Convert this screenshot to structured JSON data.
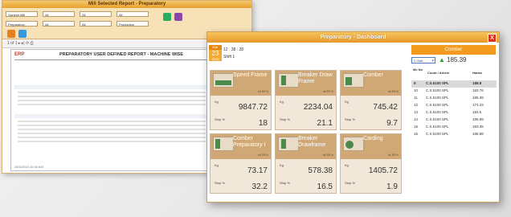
{
  "report_window": {
    "title": "Mill Selected Report - Preparatory",
    "filters": [
      {
        "label": "Mill/Plant",
        "value": "Ganesh Mill",
        "type": "select"
      },
      {
        "label": "From",
        "value": "28",
        "type": "select"
      },
      {
        "label": "To",
        "value": "28",
        "type": "select"
      },
      {
        "label": "Shift",
        "value": "All",
        "type": "select"
      },
      {
        "label": "Dept",
        "value": "Preparatory",
        "type": "select"
      },
      {
        "label": "Machine Type",
        "value": "All",
        "type": "select"
      },
      {
        "label": "Machine",
        "value": "All",
        "type": "select"
      },
      {
        "label": "Report",
        "value": "Production",
        "type": "select"
      }
    ],
    "toolbar_text": "1 of 1  ▸ ▸|  ⟳  ⎙",
    "report_logo": "ERP",
    "report_title": "PREPARATORY USER DEFINED REPORT - MACHINE WISE",
    "report_footer": "28/3/2015 10:40 AM"
  },
  "dashboard": {
    "title": "Preparatory - Dashboard",
    "close_label": "X",
    "date": {
      "month": "Mar",
      "day": "23",
      "year": "2015"
    },
    "time": "12 : 38 : 28",
    "shift": "Shift 1",
    "kg_label": "Kg",
    "stop_label": "Stop %",
    "tiles": [
      {
        "name": "Speed Frame",
        "eff": "## Eff %",
        "kg": "9847.72",
        "stop": "18"
      },
      {
        "name": "Breaker Draw Frame",
        "eff": "## Eff %",
        "kg": "2234.04",
        "stop": "21.1"
      },
      {
        "name": "Comber",
        "eff": "## Eff %",
        "kg": "745.42",
        "stop": "9.7"
      },
      {
        "name": "Comber Preparatory I",
        "eff": "## Eff %",
        "kg": "73.17",
        "stop": "32.2"
      },
      {
        "name": "Breaker Drawframe",
        "eff": "## Eff %",
        "kg": "578.38",
        "stop": "16.5"
      },
      {
        "name": "Carding",
        "eff": "## Eff %",
        "kg": "1405.72",
        "stop": "1.9"
      }
    ],
    "side_panel": {
      "header": "Comber",
      "combo_value": "C-Sub",
      "trend_value": "185.39",
      "table_headers": [
        "Mc No",
        "Count / Article",
        "Hanks"
      ],
      "rows": [
        {
          "mc": "9",
          "count": "C.S.5100 SPL",
          "val": "188.8",
          "sel": true
        },
        {
          "mc": "10",
          "count": "C.S.5100 SPL",
          "val": "183.76"
        },
        {
          "mc": "11",
          "count": "C.S.5100 SPL",
          "val": "185.39"
        },
        {
          "mc": "12",
          "count": "C.S.5100 SPL",
          "val": "174.23"
        },
        {
          "mc": "13",
          "count": "C.S.5100 SPL",
          "val": "183.5"
        },
        {
          "mc": "14",
          "count": "C.S.5100 SPL",
          "val": "185.99"
        },
        {
          "mc": "15",
          "count": "C.S.5100 SPL",
          "val": "183.35"
        },
        {
          "mc": "16",
          "count": "C.S.5100 SPL",
          "val": "185.88"
        }
      ]
    }
  }
}
